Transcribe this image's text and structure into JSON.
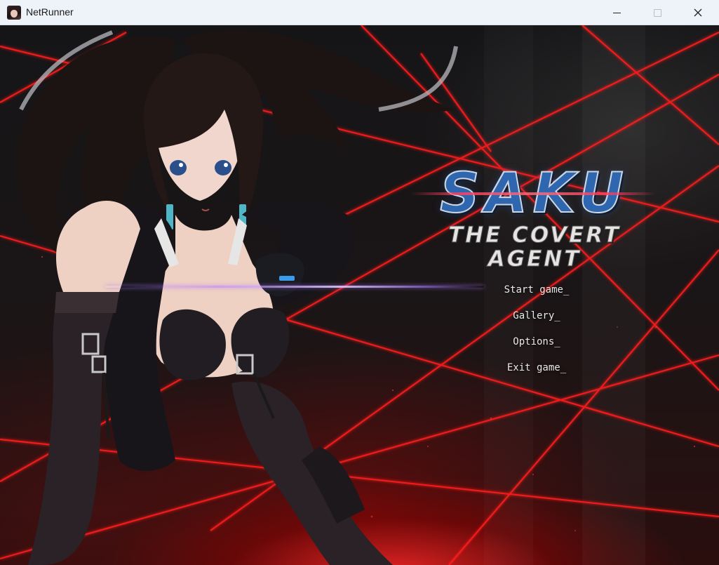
{
  "window": {
    "title": "NetRunner",
    "controls": {
      "minimize": "minimize",
      "maximize": "maximize",
      "close": "close"
    }
  },
  "logo": {
    "title": "SAKU",
    "subtitle": "THE COVERT AGENT"
  },
  "menu": {
    "items": [
      {
        "label": "Start game_"
      },
      {
        "label": "Gallery_"
      },
      {
        "label": "Options_"
      },
      {
        "label": "Exit game_"
      }
    ],
    "highlighted_index": 0
  },
  "colors": {
    "laser": "#ff1e1e",
    "logo_blue": "#2f66b0",
    "menu_text": "#e8e8e8",
    "selector_beam": "#b88cff"
  }
}
